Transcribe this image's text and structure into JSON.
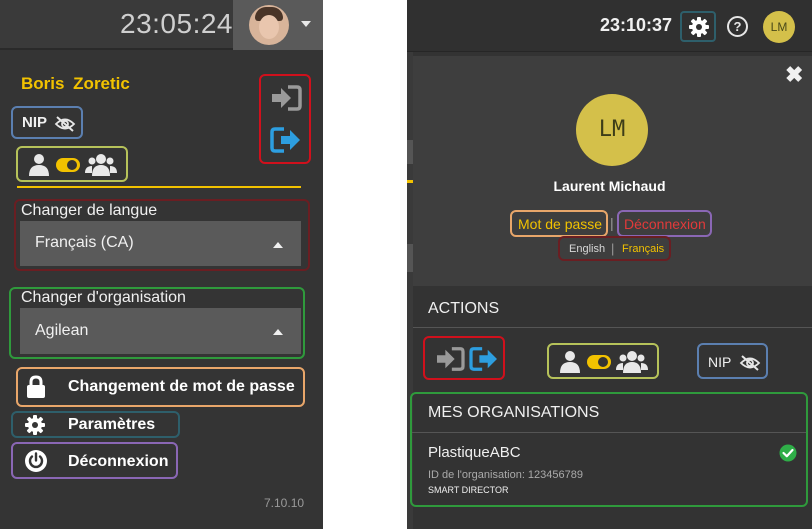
{
  "left_panel": {
    "clock": "23:05:24",
    "user_name": "Boris Zoretic",
    "nip_label": "NIP",
    "language_label": "Changer de langue",
    "language_value": "Français (CA)",
    "organisation_label": "Changer d'organisation",
    "organisation_value": "Agilean",
    "password_label": "Changement de mot de passe",
    "settings_label": "Paramètres",
    "logout_label": "Déconnexion",
    "version": "7.10.10"
  },
  "right_panel": {
    "clock": "23:10:37",
    "help_label": "?",
    "avatar_initials": "LM",
    "profile_initials": "LM",
    "profile_name": "Laurent Michaud",
    "password_link": "Mot de passe",
    "separator": "|",
    "logout_link": "Déconnexion",
    "lang_english": "English",
    "lang_french": "Français",
    "actions_title": "ACTIONS",
    "nip_label": "NIP",
    "organisations_title": "MES ORGANISATIONS",
    "organisation": {
      "name": "PlastiqueABC",
      "id_text": "ID de l'organisation: 123456789",
      "role": "SMART DIRECTOR"
    },
    "close_label": "✖"
  },
  "colors": {
    "accent_yellow": "#f2c200",
    "login_blue": "#2d9ee0",
    "logout_red": "#e23a3a",
    "check_green": "#2fae48"
  },
  "icons": [
    "login-icon",
    "logout-icon",
    "eye-slash-icon",
    "user-icon",
    "toggle-icon",
    "users-icon",
    "lock-icon",
    "gear-icon",
    "power-icon",
    "check-circle-icon",
    "close-icon",
    "help-icon",
    "chevron-down-icon",
    "caret-up-icon"
  ]
}
